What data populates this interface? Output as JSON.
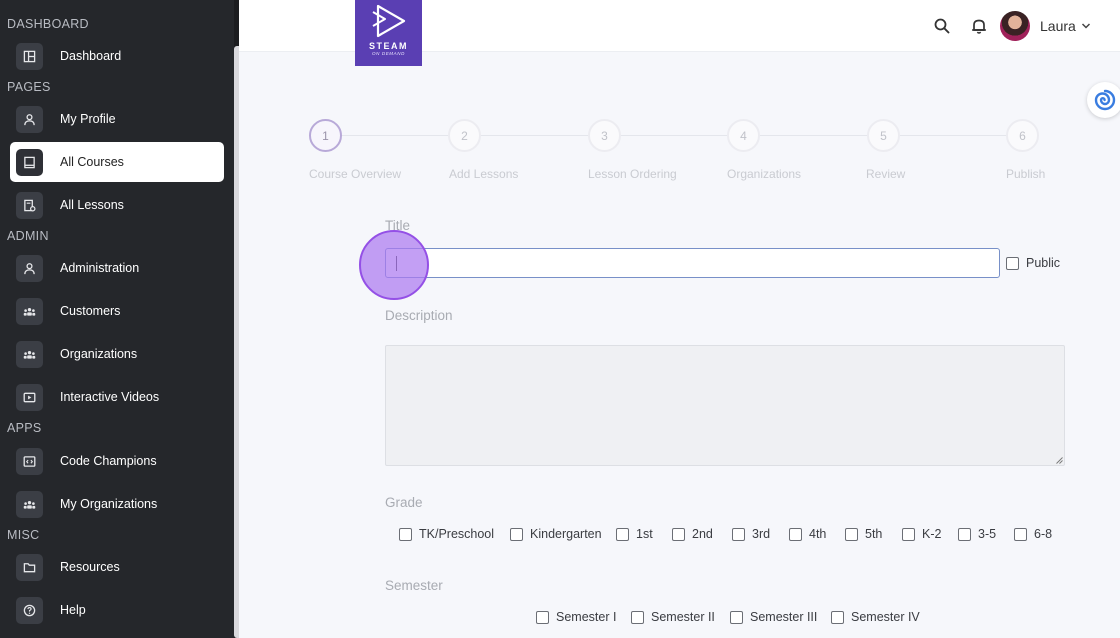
{
  "sidebar": {
    "sections": [
      {
        "title": "DASHBOARD"
      },
      {
        "title": "PAGES"
      },
      {
        "title": "ADMIN"
      },
      {
        "title": "APPS"
      },
      {
        "title": "MISC"
      }
    ],
    "items": [
      {
        "label": "Dashboard",
        "icon": "dashboard-icon"
      },
      {
        "label": "My Profile",
        "icon": "user-icon"
      },
      {
        "label": "All Courses",
        "icon": "book-icon",
        "active": true
      },
      {
        "label": "All Lessons",
        "icon": "lessons-icon"
      },
      {
        "label": "Administration",
        "icon": "user-icon"
      },
      {
        "label": "Customers",
        "icon": "group-icon"
      },
      {
        "label": "Organizations",
        "icon": "group-icon"
      },
      {
        "label": "Interactive Videos",
        "icon": "video-icon"
      },
      {
        "label": "Code Champions",
        "icon": "code-icon"
      },
      {
        "label": "My Organizations",
        "icon": "group-icon"
      },
      {
        "label": "Resources",
        "icon": "folder-icon"
      },
      {
        "label": "Help",
        "icon": "help-icon"
      }
    ]
  },
  "header": {
    "logo_text": "STEAM",
    "logo_subtext": "ON DEMAND",
    "user_name": "Laura"
  },
  "stepper": {
    "current": 1,
    "steps": [
      {
        "number": "1",
        "label": "Course Overview"
      },
      {
        "number": "2",
        "label": "Add Lessons"
      },
      {
        "number": "3",
        "label": "Lesson Ordering"
      },
      {
        "number": "4",
        "label": "Organizations"
      },
      {
        "number": "5",
        "label": "Review"
      },
      {
        "number": "6",
        "label": "Publish"
      }
    ]
  },
  "form": {
    "title_label": "Title",
    "title_value": "",
    "public_label": "Public",
    "description_label": "Description",
    "description_value": "",
    "grade_label": "Grade",
    "grades": [
      "TK/Preschool",
      "Kindergarten",
      "1st",
      "2nd",
      "3rd",
      "4th",
      "5th",
      "K-2",
      "3-5",
      "6-8"
    ],
    "semester_label": "Semester",
    "semesters": [
      "Semester I",
      "Semester II",
      "Semester III",
      "Semester IV"
    ]
  },
  "colors": {
    "sidebar_bg": "#25272b",
    "brand": "#5a3fb3",
    "click_highlight": "#ac7af0"
  }
}
